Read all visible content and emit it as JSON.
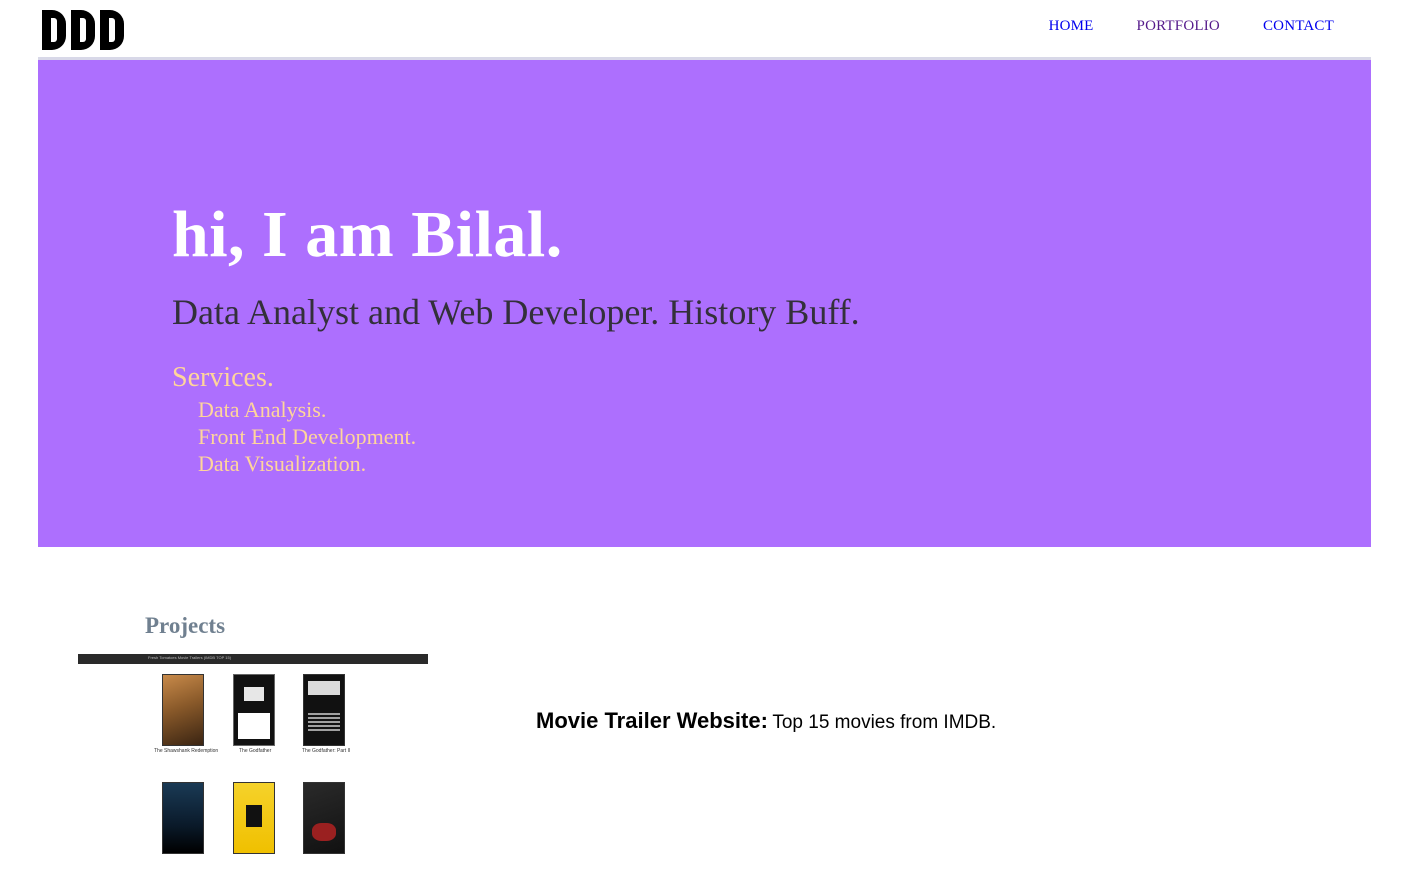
{
  "nav": {
    "items": [
      {
        "label": "HOME"
      },
      {
        "label": "PORTFOLIO"
      },
      {
        "label": "CONTACT"
      }
    ]
  },
  "hero": {
    "title": "hi, I am Bilal.",
    "tagline": "Data Analyst and Web Developer. History Buff.",
    "services_title": "Services.",
    "services": [
      "Data Analysis.",
      "Front End Development.",
      "Data Visualization."
    ]
  },
  "projects": {
    "title": "Projects",
    "items": [
      {
        "name": "Movie Trailer Website:",
        "description": "Top 15 movies from IMDB.",
        "screenshot": {
          "header": "Fresh Tomatoes Movie Trailers (IMDB TOP 15)",
          "posters": [
            {
              "caption": "The Shawshank Redemption"
            },
            {
              "caption": "The Godfather"
            },
            {
              "caption": "The Godfather: Part II"
            },
            {
              "caption": ""
            },
            {
              "caption": ""
            },
            {
              "caption": ""
            }
          ]
        }
      }
    ]
  },
  "colors": {
    "hero_bg": "#ad6ffe",
    "title": "#ffffff",
    "tagline": "#33303a",
    "services": "#ffd59a",
    "projects_title": "#708090",
    "link": "#0000ee",
    "link_visited": "#551a8b"
  }
}
